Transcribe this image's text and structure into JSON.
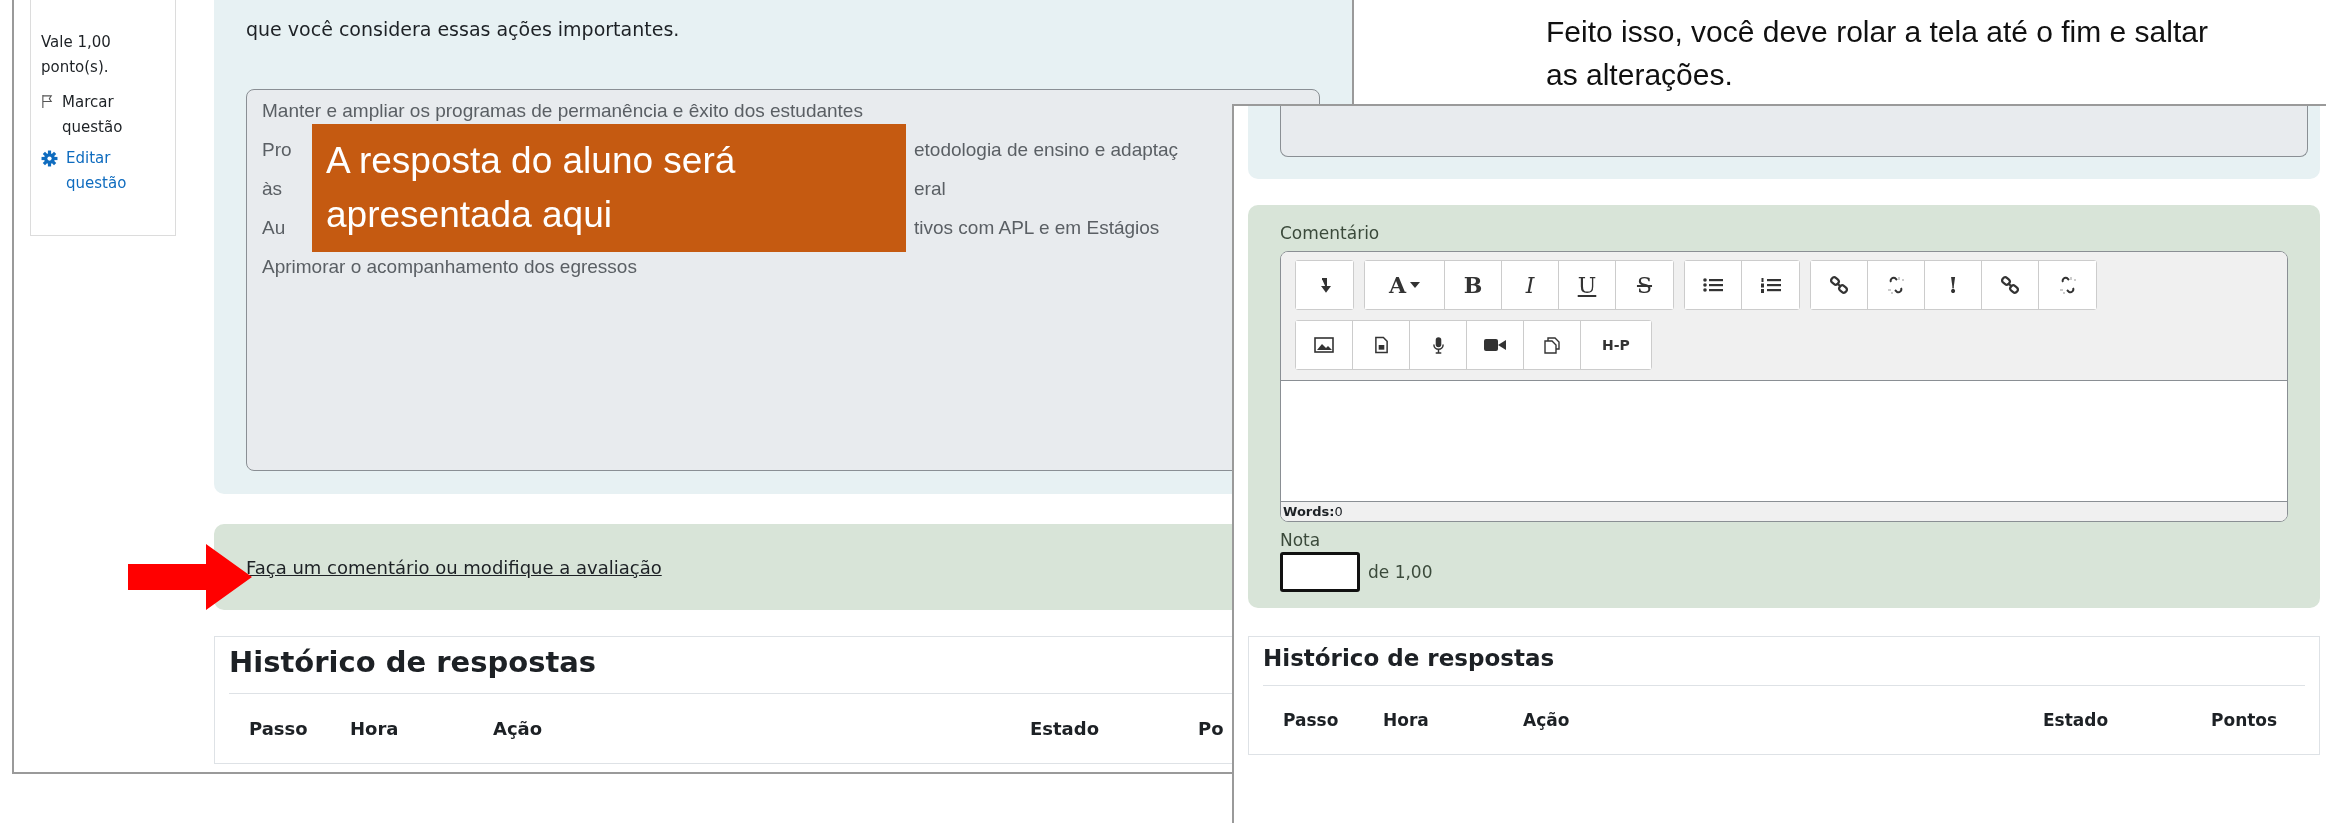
{
  "instruction": "Feito isso, você deve rolar a tela até o fim e saltar as alterações.",
  "left_screen": {
    "sidebar": {
      "grade_info": "Vale 1,00 ponto(s).",
      "flag_link": "Marcar questão",
      "edit_link": "Editar questão"
    },
    "question_text": "que você considera essas ações importantes.",
    "answer_lines": [
      {
        "left": "Manter e ampliar os programas de permanência e êxito dos estudantes"
      },
      {
        "left": "Pro",
        "right": "etodologia de ensino e adaptaç"
      },
      {
        "left": "às",
        "right": "eral"
      },
      {
        "left": "Au",
        "right": "tivos com APL e em Estágios"
      },
      {
        "left": "Aprimorar o acompanhamento dos egressos"
      }
    ],
    "callout": "A resposta do aluno será apresentada aqui",
    "comment_link": "Faça um comentário ou modifique a avaliação",
    "history": {
      "title": "Histórico de respostas",
      "columns": [
        "Passo",
        "Hora",
        "Ação",
        "Estado",
        "Po"
      ]
    }
  },
  "right_screen": {
    "comment_label": "Comentário",
    "toolbar": [
      [
        [
          {
            "kind": "icon"
          }
        ],
        [
          {
            "kind": "glyph",
            "label": "A",
            "caret": true
          },
          {
            "kind": "glyph",
            "label": "B"
          },
          {
            "kind": "glyph",
            "label": "I"
          },
          {
            "kind": "glyph",
            "label": "U"
          },
          {
            "kind": "glyph",
            "label": "S"
          }
        ],
        [
          {
            "kind": "icon"
          },
          {
            "kind": "icon"
          }
        ],
        [
          {
            "kind": "icon"
          },
          {
            "kind": "icon"
          },
          {
            "kind": "glyph",
            "label": "!"
          },
          {
            "kind": "icon"
          },
          {
            "kind": "icon"
          }
        ]
      ],
      [
        [
          {
            "kind": "icon"
          },
          {
            "kind": "icon"
          },
          {
            "kind": "icon"
          },
          {
            "kind": "icon"
          },
          {
            "kind": "icon"
          },
          {
            "kind": "glyph",
            "label": "H-P"
          }
        ]
      ]
    ],
    "words_label": "Words:",
    "words_count": "0",
    "grade_label": "Nota",
    "grade_max": "de 1,00",
    "history": {
      "title": "Histórico de respostas",
      "columns": [
        "Passo",
        "Hora",
        "Ação",
        "Estado",
        "Pontos"
      ]
    }
  }
}
